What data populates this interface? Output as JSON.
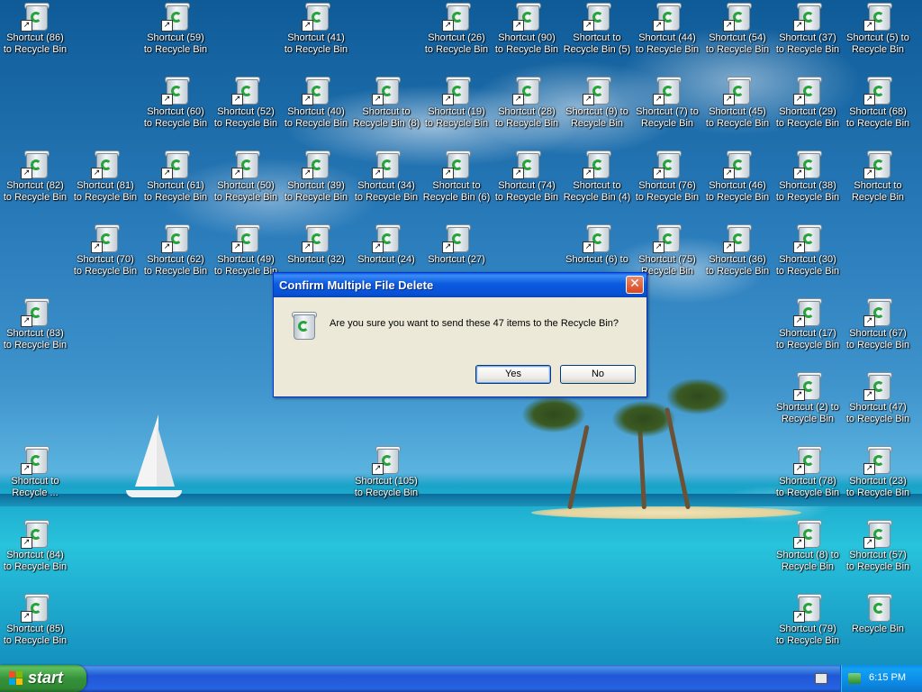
{
  "desktop": {
    "icons": [
      {
        "line1": "Shortcut (86)",
        "line2": "to Recycle Bin"
      },
      {
        "line1": "Shortcut (59)",
        "line2": "to Recycle Bin"
      },
      {
        "line1": "Shortcut (41)",
        "line2": "to Recycle Bin"
      },
      {
        "line1": "Shortcut (26)",
        "line2": "to Recycle Bin"
      },
      {
        "line1": "Shortcut (90)",
        "line2": "to Recycle Bin"
      },
      {
        "line1": "Shortcut to",
        "line2": "Recycle Bin (5)"
      },
      {
        "line1": "Shortcut (44)",
        "line2": "to Recycle Bin"
      },
      {
        "line1": "Shortcut (54)",
        "line2": "to Recycle Bin"
      },
      {
        "line1": "Shortcut (37)",
        "line2": "to Recycle Bin"
      },
      {
        "line1": "Shortcut (5) to",
        "line2": "Recycle Bin"
      },
      {
        "line1": "Shortcut (60)",
        "line2": "to Recycle Bin"
      },
      {
        "line1": "Shortcut (52)",
        "line2": "to Recycle Bin"
      },
      {
        "line1": "Shortcut (40)",
        "line2": "to Recycle Bin"
      },
      {
        "line1": "Shortcut to",
        "line2": "Recycle Bin (8)"
      },
      {
        "line1": "Shortcut (19)",
        "line2": "to Recycle Bin"
      },
      {
        "line1": "Shortcut (28)",
        "line2": "to Recycle Bin"
      },
      {
        "line1": "Shortcut (9) to",
        "line2": "Recycle Bin"
      },
      {
        "line1": "Shortcut (7) to",
        "line2": "Recycle Bin"
      },
      {
        "line1": "Shortcut (45)",
        "line2": "to Recycle Bin"
      },
      {
        "line1": "Shortcut (29)",
        "line2": "to Recycle Bin"
      },
      {
        "line1": "Shortcut (68)",
        "line2": "to Recycle Bin"
      },
      {
        "line1": "Shortcut (82)",
        "line2": "to Recycle Bin"
      },
      {
        "line1": "Shortcut (81)",
        "line2": "to Recycle Bin"
      },
      {
        "line1": "Shortcut (61)",
        "line2": "to Recycle Bin"
      },
      {
        "line1": "Shortcut (50)",
        "line2": "to Recycle Bin"
      },
      {
        "line1": "Shortcut (39)",
        "line2": "to Recycle Bin"
      },
      {
        "line1": "Shortcut (34)",
        "line2": "to Recycle Bin"
      },
      {
        "line1": "Shortcut to",
        "line2": "Recycle Bin (6)"
      },
      {
        "line1": "Shortcut (74)",
        "line2": "to Recycle Bin"
      },
      {
        "line1": "Shortcut to",
        "line2": "Recycle Bin (4)"
      },
      {
        "line1": "Shortcut (76)",
        "line2": "to Recycle Bin"
      },
      {
        "line1": "Shortcut (46)",
        "line2": "to Recycle Bin"
      },
      {
        "line1": "Shortcut (38)",
        "line2": "to Recycle Bin"
      },
      {
        "line1": "Shortcut to",
        "line2": "Recycle Bin"
      },
      {
        "line1": "Shortcut (70)",
        "line2": "to Recycle Bin"
      },
      {
        "line1": "Shortcut (62)",
        "line2": "to Recycle Bin"
      },
      {
        "line1": "Shortcut (49)",
        "line2": "to Recycle Bin"
      },
      {
        "line1": "Shortcut (32)",
        "line2": ""
      },
      {
        "line1": "Shortcut (24)",
        "line2": ""
      },
      {
        "line1": "Shortcut (27)",
        "line2": ""
      },
      {
        "line1": "Shortcut (6) to",
        "line2": ""
      },
      {
        "line1": "Shortcut (75)",
        "line2": "Recycle Bin"
      },
      {
        "line1": "Shortcut (36)",
        "line2": "to Recycle Bin"
      },
      {
        "line1": "Shortcut (30)",
        "line2": "to Recycle Bin"
      },
      {
        "line1": "Shortcut (83)",
        "line2": "to Recycle Bin"
      },
      {
        "line1": "Shortcut (17)",
        "line2": "to Recycle Bin"
      },
      {
        "line1": "Shortcut (67)",
        "line2": "to Recycle Bin"
      },
      {
        "line1": "Shortcut (2) to",
        "line2": "Recycle Bin"
      },
      {
        "line1": "Shortcut (47)",
        "line2": "to Recycle Bin"
      },
      {
        "line1": "Shortcut to",
        "line2": "Recycle ..."
      },
      {
        "line1": "Shortcut (105)",
        "line2": "to Recycle Bin"
      },
      {
        "line1": "Shortcut (78)",
        "line2": "to Recycle Bin"
      },
      {
        "line1": "Shortcut (23)",
        "line2": "to Recycle Bin"
      },
      {
        "line1": "Shortcut (84)",
        "line2": "to Recycle Bin"
      },
      {
        "line1": "Shortcut (8) to",
        "line2": "Recycle Bin"
      },
      {
        "line1": "Shortcut (57)",
        "line2": "to Recycle Bin"
      },
      {
        "line1": "Shortcut (85)",
        "line2": "to Recycle Bin"
      },
      {
        "line1": "Shortcut (79)",
        "line2": "to Recycle Bin"
      },
      {
        "line1": "Recycle Bin",
        "line2": ""
      }
    ]
  },
  "dialog": {
    "title": "Confirm Multiple File Delete",
    "close_label": "✕",
    "message": "Are you sure you want to send these 47 items to the Recycle Bin?",
    "yes_label": "Yes",
    "no_label": "No"
  },
  "taskbar": {
    "start_label": "start",
    "clock": "6:15 PM"
  },
  "colors": {
    "titlebar": "#0a5adf",
    "start_button": "#36923a",
    "taskbar": "#2157d7"
  }
}
